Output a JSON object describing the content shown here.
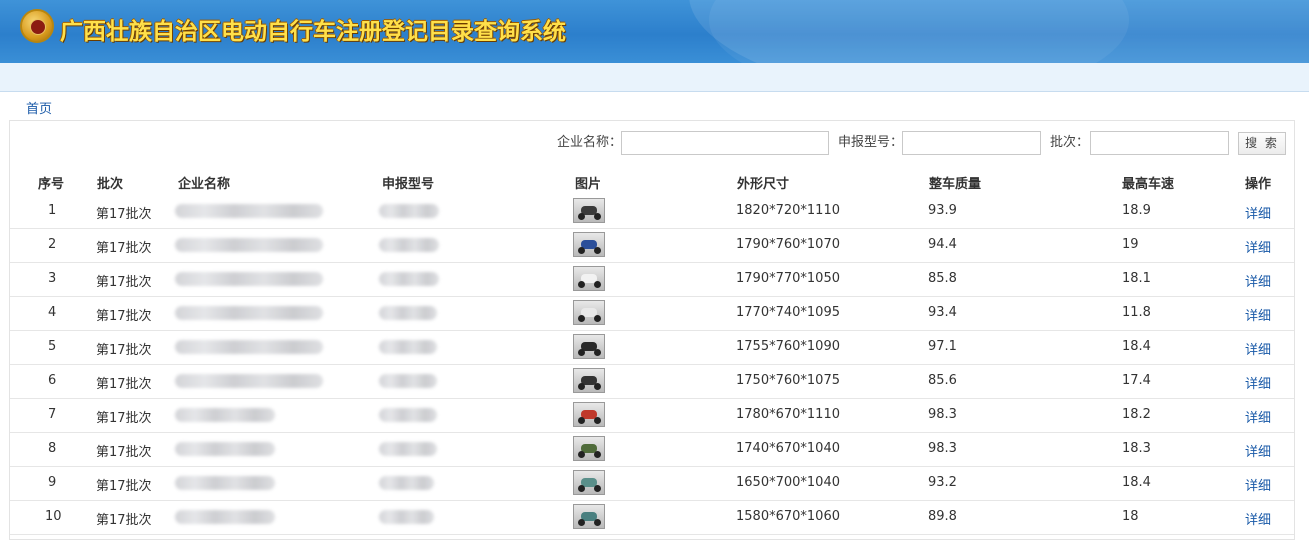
{
  "header": {
    "title": "广西壮族自治区电动自行车注册登记目录查询系统"
  },
  "breadcrumb": {
    "home": "首页"
  },
  "search": {
    "company_label": "企业名称：",
    "model_label": "申报型号：",
    "batch_label": "批次：",
    "button": "搜 索",
    "company_value": "",
    "model_value": "",
    "batch_value": ""
  },
  "table": {
    "headers": [
      "序号",
      "批次",
      "企业名称",
      "申报型号",
      "图片",
      "外形尺寸",
      "整车质量",
      "最高车速",
      "操作"
    ],
    "rows": [
      {
        "no": "1",
        "batch": "第17批次",
        "size": "1820*720*1110",
        "weight": "93.9",
        "speed": "18.9",
        "action": "详细",
        "color": "#3a3a3a"
      },
      {
        "no": "2",
        "batch": "第17批次",
        "size": "1790*760*1070",
        "weight": "94.4",
        "speed": "19",
        "action": "详细",
        "color": "#2b4f9a"
      },
      {
        "no": "3",
        "batch": "第17批次",
        "size": "1790*770*1050",
        "weight": "85.8",
        "speed": "18.1",
        "action": "详细",
        "color": "#f2f2f2"
      },
      {
        "no": "4",
        "batch": "第17批次",
        "size": "1770*740*1095",
        "weight": "93.4",
        "speed": "11.8",
        "action": "详细",
        "color": "#e9e9e9"
      },
      {
        "no": "5",
        "batch": "第17批次",
        "size": "1755*760*1090",
        "weight": "97.1",
        "speed": "18.4",
        "action": "详细",
        "color": "#2a2a2a"
      },
      {
        "no": "6",
        "batch": "第17批次",
        "size": "1750*760*1075",
        "weight": "85.6",
        "speed": "17.4",
        "action": "详细",
        "color": "#333333"
      },
      {
        "no": "7",
        "batch": "第17批次",
        "size": "1780*670*1110",
        "weight": "98.3",
        "speed": "18.2",
        "action": "详细",
        "color": "#c0392b"
      },
      {
        "no": "8",
        "batch": "第17批次",
        "size": "1740*670*1040",
        "weight": "98.3",
        "speed": "18.3",
        "action": "详细",
        "color": "#4f6b3a"
      },
      {
        "no": "9",
        "batch": "第17批次",
        "size": "1650*700*1040",
        "weight": "93.2",
        "speed": "18.4",
        "action": "详细",
        "color": "#5a8f8a"
      },
      {
        "no": "10",
        "batch": "第17批次",
        "size": "1580*670*1060",
        "weight": "89.8",
        "speed": "18",
        "action": "详细",
        "color": "#4a8080"
      }
    ]
  },
  "colors": {
    "header_blue": "#2c7fcc",
    "title_yellow": "#ffe04a",
    "link_blue": "#1a5aa8"
  }
}
